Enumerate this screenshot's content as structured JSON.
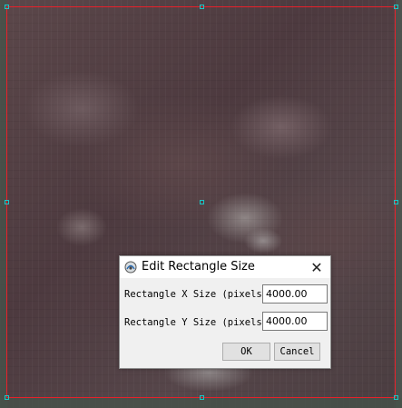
{
  "dialog": {
    "title": "Edit Rectangle Size",
    "x_label": "Rectangle X Size (pixels)",
    "x_value": "4000.00",
    "y_label": "Rectangle Y Size (pixels)",
    "y_value": "4000.00",
    "ok_label": "OK",
    "cancel_label": "Cancel",
    "close_glyph": "✕"
  },
  "colors": {
    "selection_border": "#e8202a",
    "handle": "#19c8c8"
  },
  "icons": {
    "app": "app-logo-icon",
    "close": "close-icon"
  }
}
